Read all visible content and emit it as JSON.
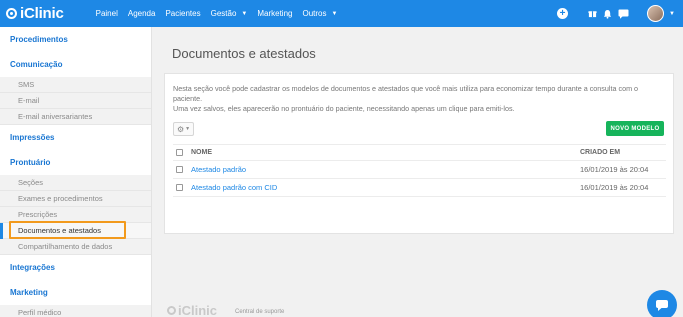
{
  "app": {
    "logo_text": "iClinic"
  },
  "nav": {
    "items": [
      {
        "label": "Painel"
      },
      {
        "label": "Agenda"
      },
      {
        "label": "Pacientes"
      },
      {
        "label": "Gestão"
      },
      {
        "label": "Marketing"
      },
      {
        "label": "Outros"
      }
    ]
  },
  "top_icons": {
    "plus": "+",
    "gift": "🎁",
    "bell": "🔔",
    "chat": "💬",
    "avatar_caret": "▼"
  },
  "sidebar": {
    "sections": [
      {
        "label": "Procedimentos"
      },
      {
        "label": "Comunicação",
        "items": [
          "SMS",
          "E-mail",
          "E-mail aniversariantes"
        ]
      },
      {
        "label": "Impressões"
      },
      {
        "label": "Prontuário",
        "items": [
          "Seções",
          "Exames e procedimentos",
          "Prescrições",
          "Documentos e atestados",
          "Compartilhamento de dados"
        ]
      },
      {
        "label": "Integrações"
      },
      {
        "label": "Marketing",
        "items": [
          "Perfil médico"
        ]
      }
    ]
  },
  "main": {
    "title": "Documentos e atestados",
    "description_1": "Nesta seção você pode cadastrar os modelos de documentos e atestados que você mais utiliza para economizar tempo durante a consulta com o paciente.",
    "description_2": "Uma vez salvos, eles aparecerão no prontuário do paciente, necessitando apenas um clique para emiti-los.",
    "new_button": "NOVO MODELO",
    "table": {
      "headers": {
        "name": "NOME",
        "created": "CRIADO EM"
      },
      "rows": [
        {
          "name": "Atestado padrão",
          "created": "16/01/2019 às 20:04"
        },
        {
          "name": "Atestado padrão com CID",
          "created": "16/01/2019 às 20:04"
        }
      ]
    }
  },
  "footer": {
    "logo_text": "iClinic",
    "link": "Central de suporte"
  },
  "colors": {
    "primary": "#1e88e5",
    "success": "#16b45b",
    "highlight": "#f29a1d"
  }
}
